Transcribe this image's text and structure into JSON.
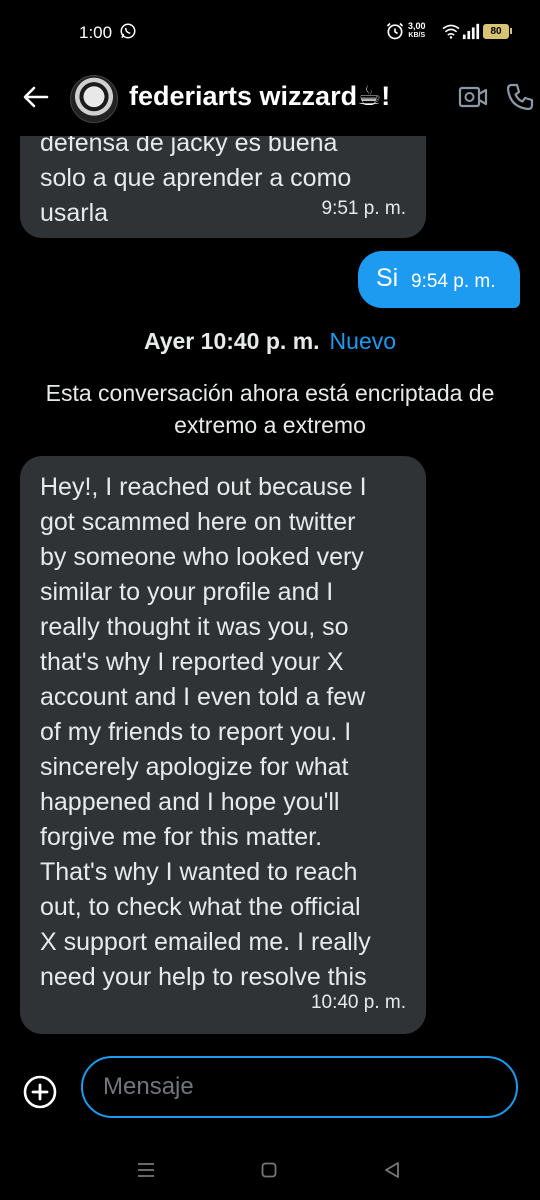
{
  "status_bar": {
    "time": "1:00",
    "net_speed_value": "3,00",
    "net_speed_unit": "KB/S",
    "battery": "80"
  },
  "header": {
    "contact_name": "federiarts wizzard☕!"
  },
  "messages": [
    {
      "direction": "incoming",
      "text": "defensa de jacky es buena\nsolo a que aprender a como\nusarla",
      "time": "9:51 p. m."
    },
    {
      "direction": "outgoing",
      "text": "Si",
      "time": "9:54 p. m."
    }
  ],
  "day_separator": {
    "label": "Ayer 10:40 p. m.",
    "new_label": "Nuevo"
  },
  "encryption_notice": "Esta conversación ahora está encriptada de extremo a extremo",
  "new_message": {
    "direction": "incoming",
    "text": "Hey!, I reached out because I\ngot scammed here on twitter\nby someone who looked very\nsimilar to your profile and I\nreally thought it was you, so\nthat's why I reported your X\naccount and I even told a few\nof my friends to report you. I\nsincerely apologize for what\nhappened and I hope you'll\nforgive me for this matter.\nThat's why I wanted to reach\nout, to check what the official\nX support emailed me. I really\nneed your help to resolve this",
    "time": "10:40 p. m."
  },
  "composer": {
    "placeholder": "Mensaje",
    "value": ""
  },
  "colors": {
    "accent": "#1d9bf0",
    "bubble_incoming": "#2f3336",
    "background": "#000000"
  }
}
